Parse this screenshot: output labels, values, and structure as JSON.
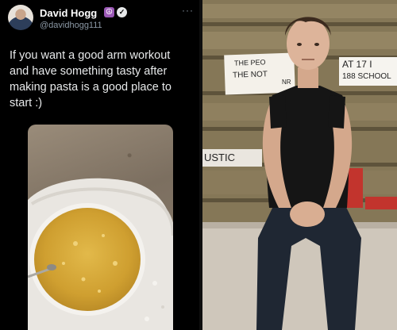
{
  "tweet": {
    "author_name": "David Hogg",
    "author_handle": "@davidhogg111",
    "badge_emoji": "☮",
    "verified_icon": "✓",
    "more_icon": "···",
    "text": "If you want a good arm workout and have something tasty after making pasta is a good place to start :)"
  },
  "photo": {
    "sign_1_line_1": "THE PEO",
    "sign_1_line_2": "THE NOT",
    "sign_1_line_2b": "NR",
    "sign_2_line_1": "AT 17 I",
    "sign_2_line_2": "188 SCHOOL",
    "sign_3": "USTIC"
  },
  "colors": {
    "tweet_bg": "#000000",
    "text": "#e7e9ea",
    "secondary_text": "#8b98a5"
  }
}
